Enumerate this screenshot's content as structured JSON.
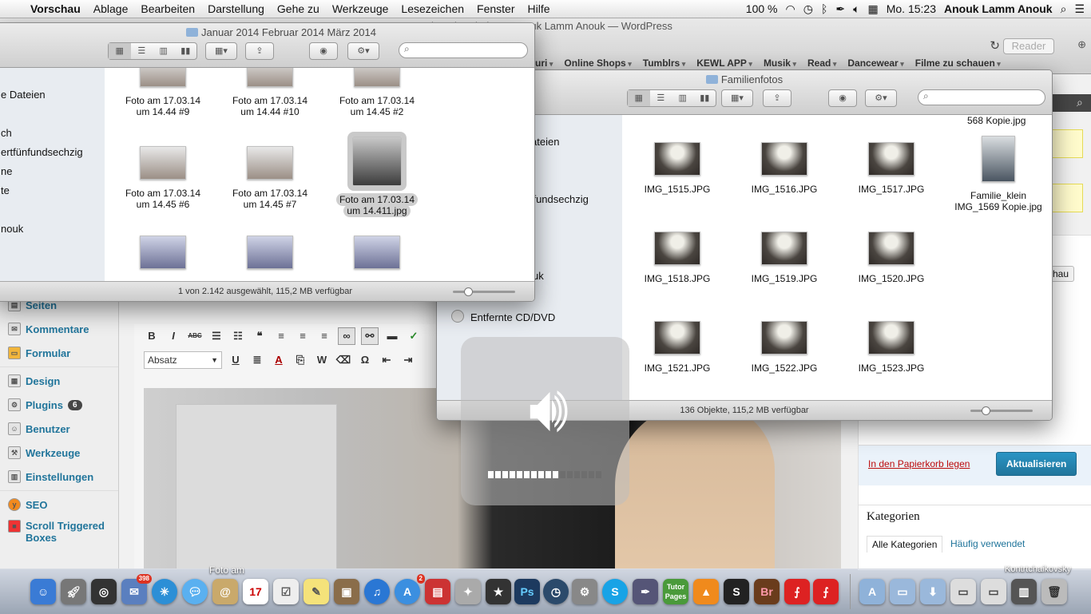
{
  "menubar": {
    "app_name": "Vorschau",
    "menus": [
      "Ablage",
      "Bearbeiten",
      "Darstellung",
      "Gehe zu",
      "Werkzeuge",
      "Lesezeichen",
      "Fenster",
      "Hilfe"
    ],
    "battery": "100 %",
    "clock": "Mo. 15:23",
    "user": "Anouk Lamm Anouk"
  },
  "browser": {
    "title": "Beitrag bearbeiten ‹ Anouk Lamm Anouk — WordPress",
    "reader_label": "Reader",
    "bookmarks": [
      "Suri",
      "Online Shops",
      "Tumblrs",
      "KEWL APP",
      "Musik",
      "Read",
      "Dancewear",
      "Filme zu schauen"
    ]
  },
  "wp_sidebar": {
    "items": [
      {
        "label": "Seiten"
      },
      {
        "label": "Kommentare"
      },
      {
        "label": "Formular"
      },
      {
        "label": "Design"
      },
      {
        "label": "Plugins",
        "badge": "6"
      },
      {
        "label": "Benutzer"
      },
      {
        "label": "Werkzeuge"
      },
      {
        "label": "Einstellungen"
      },
      {
        "label": "SEO"
      },
      {
        "label": "Scroll Triggered Boxes"
      }
    ]
  },
  "editor": {
    "format_value": "Absatz"
  },
  "wp_right": {
    "trash_link": "In den Papierkorb legen",
    "update_button": "Aktualisieren",
    "categories_title": "Kategorien",
    "tab_all": "Alle Kategorien",
    "tab_frequent": "Häufig verwendet",
    "button_partial": "hau"
  },
  "finder_front": {
    "title": "Januar 2014 Februar 2014 März 2014",
    "sidebar_items": [
      "e Dateien",
      "ch",
      "ertfünfundsechzig",
      "ne",
      "te",
      "nouk"
    ],
    "files": [
      {
        "line1": "Foto am 17.03.14",
        "line2": "um 14.44 #9"
      },
      {
        "line1": "Foto am 17.03.14",
        "line2": "um 14.44 #10"
      },
      {
        "line1": "Foto am 17.03.14",
        "line2": "um 14.45 #2"
      },
      {
        "line1": "Foto am 17.03.14",
        "line2": "um 14.45 #6"
      },
      {
        "line1": "Foto am 17.03.14",
        "line2": "um 14.45 #7"
      },
      {
        "line1": "Foto am 17.03.14",
        "line2": "um 14.411.jpg"
      }
    ],
    "status": "1 von 2.142 ausgewählt, 115,2 MB verfügbar"
  },
  "finder_back": {
    "title": "Familienfotos",
    "sidebar_items": [
      "ateien",
      "ünfundsechzig",
      "uk",
      "Entfernte CD/DVD"
    ],
    "top_partial": "568 Kopie.jpg",
    "files": [
      {
        "line1": "IMG_1515.JPG",
        "line2": ""
      },
      {
        "line1": "IMG_1516.JPG",
        "line2": ""
      },
      {
        "line1": "IMG_1517.JPG",
        "line2": ""
      },
      {
        "line1": "Familie_klein",
        "line2": "IMG_1569 Kopie.jpg"
      },
      {
        "line1": "IMG_1518.JPG",
        "line2": ""
      },
      {
        "line1": "IMG_1519.JPG",
        "line2": ""
      },
      {
        "line1": "IMG_1520.JPG",
        "line2": ""
      },
      {
        "line1": "IMG_1521.JPG",
        "line2": ""
      },
      {
        "line1": "IMG_1522.JPG",
        "line2": ""
      },
      {
        "line1": "IMG_1523.JPG",
        "line2": ""
      }
    ],
    "status": "136 Objekte, 115,2 MB verfügbar"
  },
  "volume_hud": {
    "level_fraction": 0.625
  },
  "dock": {
    "stacks_label": "Foto am",
    "right_label": "Kontrtchaikovsky",
    "badges": {
      "mail": "398",
      "appstore": "2"
    }
  }
}
